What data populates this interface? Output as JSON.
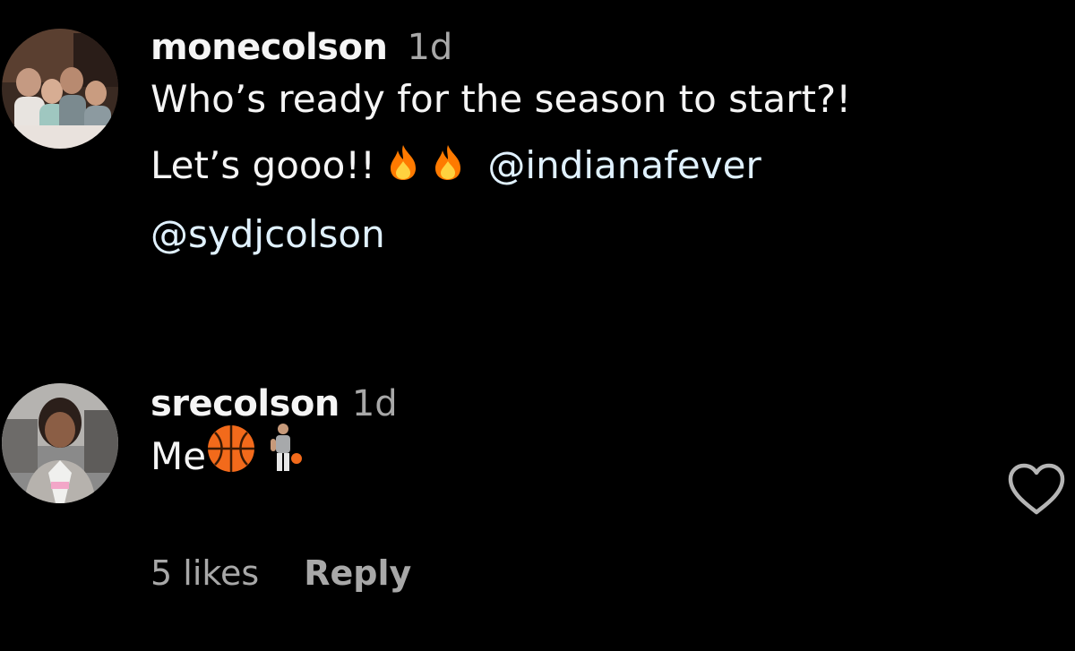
{
  "comments": [
    {
      "username": "monecolson",
      "time": "1d",
      "line1": "Who’s ready for the season to start?!",
      "line2_text": "Let’s gooo!!",
      "emojis_line2": [
        "fire-emoji",
        "fire-emoji"
      ],
      "mention1": "@indianafever",
      "mention2": "@sydjcolson"
    },
    {
      "username": "srecolson",
      "time": "1d",
      "text": "Me",
      "emojis": [
        "basketball-emoji",
        "person-bouncing-ball-emoji"
      ],
      "likes": "5 likes",
      "reply": "Reply"
    }
  ],
  "icons": {
    "like": "heart-outline-icon"
  },
  "colors": {
    "background": "#000000",
    "primary_text": "#f5f5f5",
    "secondary_text": "#a8a8a8",
    "mention": "#e0f1ff"
  }
}
